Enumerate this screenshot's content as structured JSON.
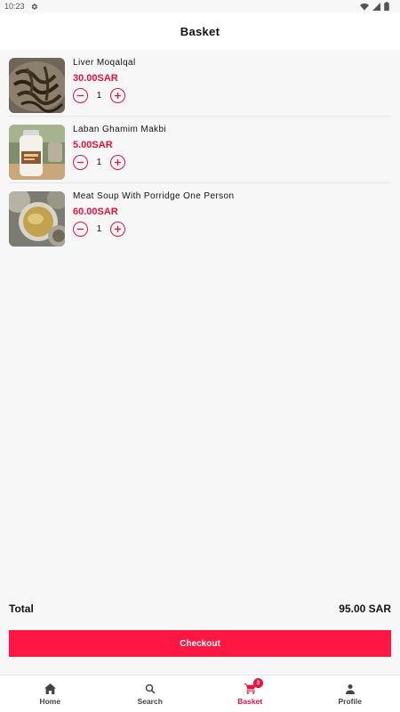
{
  "status_bar": {
    "time": "10:23"
  },
  "app_bar": {
    "title": "Basket"
  },
  "basket": {
    "items": [
      {
        "name": "Liver Moqalqal",
        "price": "30.00SAR",
        "quantity": "1",
        "image": "liver-dish-photo"
      },
      {
        "name": "Laban Ghamim Makbi",
        "price": "5.00SAR",
        "quantity": "1",
        "image": "laban-bottle-photo"
      },
      {
        "name": "Meat Soup With Porridge One Person",
        "price": "60.00SAR",
        "quantity": "1",
        "image": "soup-bowl-photo"
      }
    ]
  },
  "summary": {
    "total_label": "Total",
    "total_value": "95.00 SAR"
  },
  "checkout": {
    "label": "Checkout"
  },
  "nav": {
    "items": [
      {
        "label": "Home",
        "icon": "home-icon"
      },
      {
        "label": "Search",
        "icon": "search-icon"
      },
      {
        "label": "Basket",
        "icon": "cart-icon",
        "badge": "3"
      },
      {
        "label": "Profile",
        "icon": "person-icon"
      }
    ],
    "active": "Basket"
  },
  "colors": {
    "accent": "#e8123c",
    "checkout": "#ff1744",
    "background": "#f7f7f7"
  }
}
